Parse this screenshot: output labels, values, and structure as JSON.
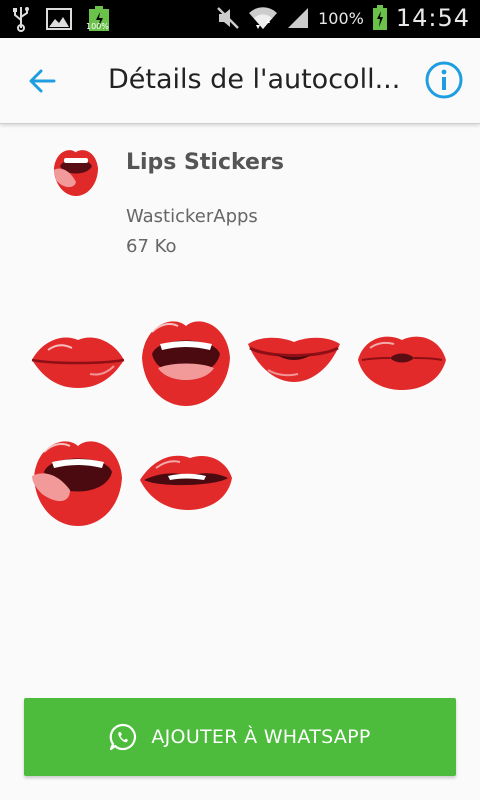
{
  "status_bar": {
    "icons": [
      "usb-icon",
      "image-icon",
      "battery-icon",
      "mute-icon",
      "wifi-icon",
      "signal-icon",
      "battery-icon"
    ],
    "small_battery_pct": "100%",
    "battery_pct": "100%",
    "time": "14:54"
  },
  "appbar": {
    "title": "Détails de l'autocoll...",
    "back_icon": "arrow-left-icon",
    "info_icon": "info-icon",
    "accent": "#1e9ee0"
  },
  "pack": {
    "name": "Lips Stickers",
    "author": "WastickerApps",
    "size": "67 Ko"
  },
  "stickers": [
    {
      "name": "lips-closed"
    },
    {
      "name": "lips-open-mouth"
    },
    {
      "name": "lips-smile"
    },
    {
      "name": "lips-kiss"
    },
    {
      "name": "lips-tongue"
    },
    {
      "name": "lips-bite"
    }
  ],
  "add_button": {
    "label": "AJOUTER À WHATSAPP",
    "icon": "whatsapp-icon",
    "color": "#4dbb3c"
  }
}
